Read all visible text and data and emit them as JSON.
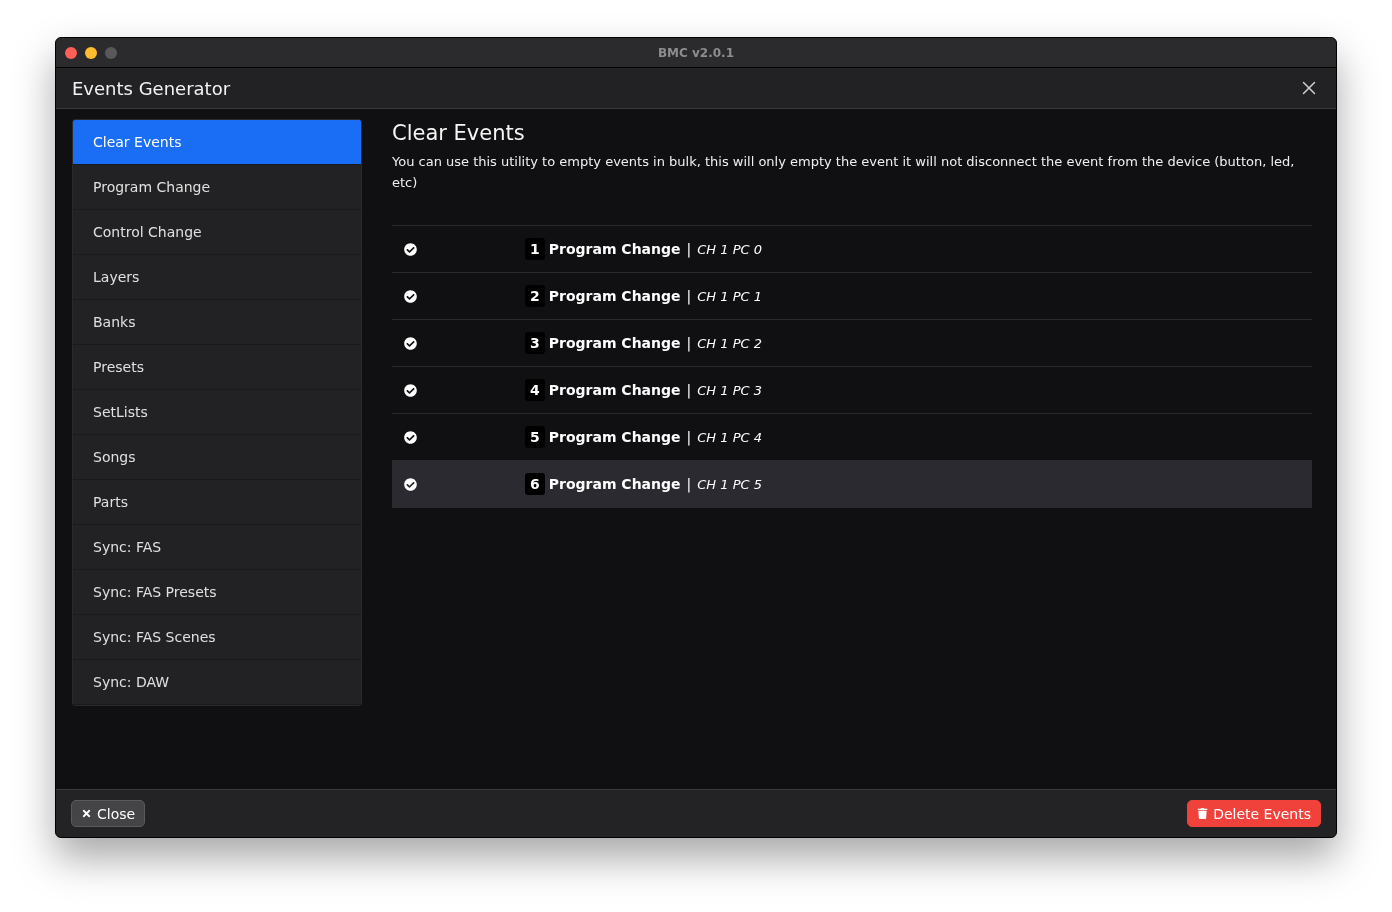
{
  "window": {
    "title": "BMC v2.0.1"
  },
  "dialog": {
    "title": "Events Generator"
  },
  "sidebar": {
    "items": [
      {
        "label": "Clear Events",
        "selected": true
      },
      {
        "label": "Program Change",
        "selected": false
      },
      {
        "label": "Control Change",
        "selected": false
      },
      {
        "label": "Layers",
        "selected": false
      },
      {
        "label": "Banks",
        "selected": false
      },
      {
        "label": "Presets",
        "selected": false
      },
      {
        "label": "SetLists",
        "selected": false
      },
      {
        "label": "Songs",
        "selected": false
      },
      {
        "label": "Parts",
        "selected": false
      },
      {
        "label": "Sync: FAS",
        "selected": false
      },
      {
        "label": "Sync: FAS Presets",
        "selected": false
      },
      {
        "label": "Sync: FAS Scenes",
        "selected": false
      },
      {
        "label": "Sync: DAW",
        "selected": false
      }
    ]
  },
  "content": {
    "heading": "Clear Events",
    "description": "You can use this utility to empty events in bulk, this will only empty the event it will not disconnect the event from the device (button, led, etc)",
    "events": [
      {
        "number": "1",
        "name": "Program Change",
        "separator": "|",
        "detail": "CH 1 PC 0",
        "checked": true,
        "selected": false
      },
      {
        "number": "2",
        "name": "Program Change",
        "separator": "|",
        "detail": "CH 1 PC 1",
        "checked": true,
        "selected": false
      },
      {
        "number": "3",
        "name": "Program Change",
        "separator": "|",
        "detail": "CH 1 PC 2",
        "checked": true,
        "selected": false
      },
      {
        "number": "4",
        "name": "Program Change",
        "separator": "|",
        "detail": "CH 1 PC 3",
        "checked": true,
        "selected": false
      },
      {
        "number": "5",
        "name": "Program Change",
        "separator": "|",
        "detail": "CH 1 PC 4",
        "checked": true,
        "selected": false
      },
      {
        "number": "6",
        "name": "Program Change",
        "separator": "|",
        "detail": "CH 1 PC 5",
        "checked": true,
        "selected": true
      }
    ]
  },
  "footer": {
    "close_button": "Close",
    "delete_button": "Delete Events"
  }
}
